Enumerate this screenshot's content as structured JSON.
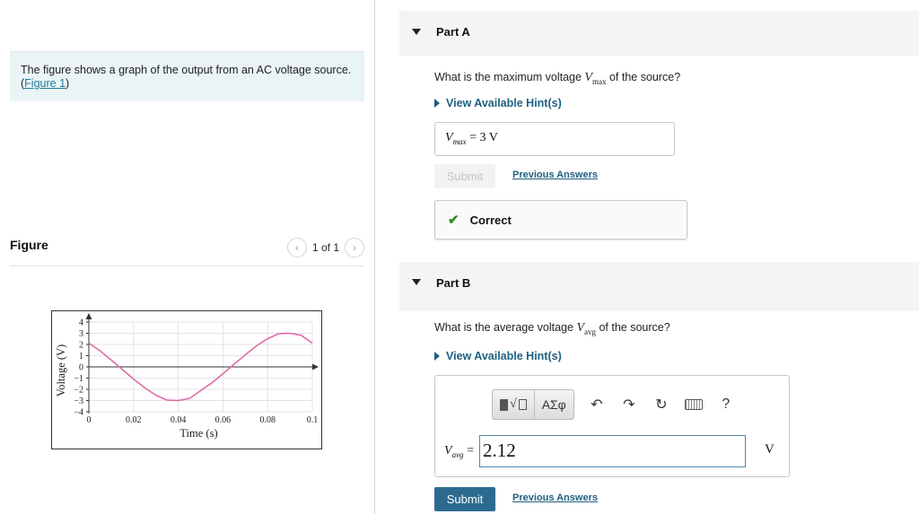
{
  "intro": {
    "text": "The figure shows a graph of the output from an AC voltage source. (",
    "link": "Figure 1",
    "text_end": ")"
  },
  "figure": {
    "title": "Figure",
    "pager": "1 of 1",
    "prev_icon": "chevron-left-icon",
    "next_icon": "chevron-right-icon"
  },
  "chart_data": {
    "type": "line",
    "title": "",
    "xlabel": "Time (s)",
    "ylabel": "Voltage (V)",
    "x_ticks": [
      "0",
      "0.02",
      "0.04",
      "0.06",
      "0.08",
      "0.1"
    ],
    "y_ticks": [
      "4",
      "3",
      "2",
      "1",
      "0",
      "−1",
      "−2",
      "−3",
      "−4"
    ],
    "xlim": [
      0,
      0.1
    ],
    "ylim": [
      -4,
      4
    ],
    "grid": true,
    "series": [
      {
        "x": [
          0,
          0.005,
          0.01,
          0.015,
          0.02,
          0.025,
          0.03,
          0.035,
          0.04,
          0.045,
          0.05,
          0.055,
          0.06,
          0.065,
          0.07,
          0.075,
          0.08,
          0.085,
          0.09,
          0.095,
          0.1
        ],
        "y": [
          2.12,
          1.43,
          0.62,
          -0.23,
          -1.08,
          -1.87,
          -2.52,
          -2.97,
          -3.0,
          -2.82,
          -2.12,
          -1.43,
          -0.62,
          0.23,
          1.08,
          1.87,
          2.52,
          2.97,
          3.0,
          2.82,
          2.12
        ],
        "color": "#e06aa8"
      }
    ]
  },
  "partA": {
    "label": "Part A",
    "question_pre": "What is the maximum voltage ",
    "var": "V",
    "var_sub": "max",
    "question_post": " of the source?",
    "hint": "View Available Hint(s)",
    "answer_var": "V",
    "answer_sub": "max",
    "answer_value": " =  3  V",
    "submit": "Submit",
    "previous": "Previous Answers",
    "result": "Correct",
    "result_icon": "checkmark-icon"
  },
  "partB": {
    "label": "Part B",
    "question_pre": "What is the average voltage ",
    "var": "V",
    "var_sub": "avg",
    "question_post": " of the source?",
    "hint": "View Available Hint(s)",
    "toolbar": {
      "templates_label": "√",
      "greek": "ΑΣφ",
      "help": "?"
    },
    "eq_var": "V",
    "eq_sub": "avg",
    "eq_sign": " =",
    "input_value": "2.12",
    "unit": "V",
    "submit": "Submit",
    "previous": "Previous Answers"
  },
  "colors": {
    "accent": "#2c6b8f",
    "link": "#1d5f80",
    "correct": "#3a8a2c",
    "curve": "#e06aa8"
  }
}
